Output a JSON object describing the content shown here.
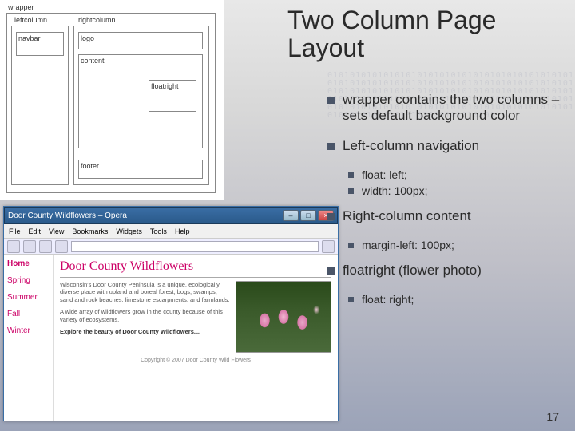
{
  "slide": {
    "title": "Two Column Page Layout",
    "page_number": "17"
  },
  "bullets": {
    "b1": "wrapper contains the two columns – sets default background color",
    "b2": "Left-column navigation",
    "b2a": "float: left;",
    "b2b": "width: 100px;",
    "b3": "Right-column content",
    "b3a": "margin-left: 100px;",
    "b4": "floatright (flower photo)",
    "b4a": "float: right;"
  },
  "diagram": {
    "wrapper": "wrapper",
    "leftcolumn": "leftcolumn",
    "rightcolumn": "rightcolumn",
    "navbar": "navbar",
    "logo": "logo",
    "content": "content",
    "floatright": "floatright",
    "footer": "footer"
  },
  "browser": {
    "window_title": "Door County Wildflowers – Opera",
    "menu": [
      "File",
      "Edit",
      "View",
      "Bookmarks",
      "Widgets",
      "Tools",
      "Help"
    ],
    "nav_items": [
      "Home",
      "Spring",
      "Summer",
      "Fall",
      "Winter"
    ],
    "site_title": "Door County Wildflowers",
    "para1": "Wisconsin's Door County Peninsula is a unique, ecologically diverse place with upland and boreal forest, bogs, swamps, sand and rock beaches, limestone escarpments, and farmlands.",
    "para2": "A wide array of wildflowers grow in the county because of this variety of ecosystems.",
    "para3": "Explore the beauty of Door County Wildflowers....",
    "copyright": "Copyright © 2007 Door County Wild Flowers"
  }
}
